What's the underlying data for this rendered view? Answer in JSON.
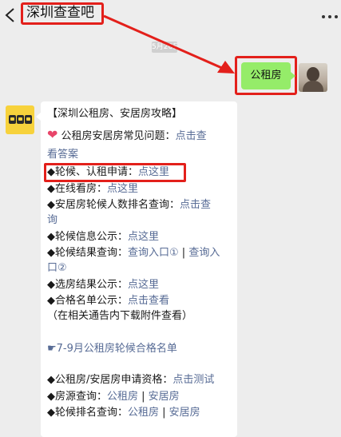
{
  "header": {
    "title": "深圳查查吧",
    "back_icon": "chevron-left-icon",
    "more_icon": "more-dots-icon"
  },
  "timestamp": "5月26日",
  "my_message": {
    "text": "公租房"
  },
  "bot_message": {
    "heading": "【深圳公租房、安居房攻略】",
    "faq_label": "公租房安居房常见问题：",
    "faq_link_a": "点击查",
    "faq_link_b": "看答案",
    "apply_label": "◆轮候、认租申请：",
    "apply_link": "点这里",
    "online_label": "◆在线看房：",
    "online_link": "点这里",
    "rank_label": "◆安居房轮候人数排名查询：",
    "rank_link_a": "点击查",
    "rank_link_b": "询",
    "info_label": "◆轮候信息公示：",
    "info_link": "点这里",
    "result_label": "◆轮候结果查询：",
    "result_link1": "查询入口①",
    "result_sep": " | ",
    "result_link2_a": "查询入",
    "result_link2_b": "口②",
    "select_label": "◆选房结果公示：",
    "select_link": "点这里",
    "pass_label": "◆合格名单公示：",
    "pass_link": "点击查看",
    "note": "（在相关通告内下载附件查看）",
    "july_link": "☛7-9月公租房轮候合格名单",
    "qual_label": "◆公租房/安居房申请资格：",
    "qual_link": "点击测试",
    "source_label": "◆房源查询：",
    "source_link1": "公租房",
    "source_sep": " | ",
    "source_link2": "安居房",
    "queue_label": "◆轮候排名查询：",
    "queue_link1": "公租房",
    "queue_sep": " | ",
    "queue_link2": "安居房"
  },
  "colors": {
    "background": "#ededed",
    "my_bubble": "#95ec69",
    "bot_bubble": "#ffffff",
    "link": "#576b95",
    "annotation_red": "#e3201b",
    "heart": "#e8456a"
  }
}
